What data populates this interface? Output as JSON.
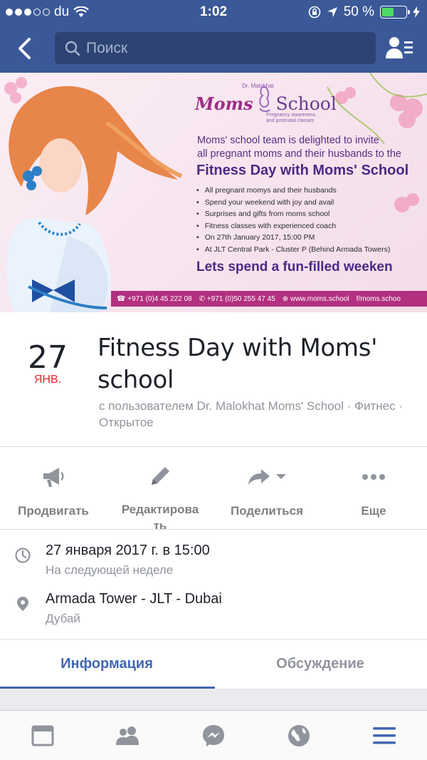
{
  "status_bar": {
    "carrier": "du",
    "time": "1:02",
    "battery_percent": "50 %",
    "battery_level": 0.5
  },
  "nav": {
    "search_placeholder": "Поиск"
  },
  "banner": {
    "logo_prefix": "Dr. Malokhat",
    "logo_moms": "Moms",
    "logo_school": "School",
    "logo_tagline_1": "Pregnancy awareness",
    "logo_tagline_2": "and postnatal classes",
    "intro_line_1": "Moms' school team is delighted to invite",
    "intro_line_2": "all pregnant moms and their husbands to the",
    "headline": "Fitness Day with Moms' School",
    "bullets": [
      "All pregnant momys and their husbands",
      "Spend your weekend with joy and avail",
      "Surprises and gifts from moms school",
      "Fitness classes with experienced coach",
      "On 27th January 2017,  15:00 PM",
      "At JLT Central Park - Cluster P (Behind Armada Towers)"
    ],
    "cta": "Lets spend a fun-filled weeken",
    "contacts": [
      "+971 (0)4 45 222 08",
      "+971 (0)50 255 47 45",
      "www.moms.school",
      "f/moms.schoo"
    ]
  },
  "event": {
    "day": "27",
    "month": "ЯНВ.",
    "title": "Fitness Day with Moms' school",
    "meta": "с пользователем Dr. Malokhat Moms' School · Фитнес · Открытое"
  },
  "actions": [
    {
      "label": "Продвигать",
      "icon": "megaphone-icon"
    },
    {
      "label": "Редактирова ть",
      "icon": "pencil-icon"
    },
    {
      "label": "Поделиться",
      "icon": "share-icon"
    },
    {
      "label": "Еще",
      "icon": "more-icon"
    }
  ],
  "details": {
    "datetime": "27 января 2017 г. в 15:00",
    "datetime_sub": "На следующей неделе",
    "location": "Armada Tower - JLT - Dubai",
    "location_sub": "Дубай"
  },
  "tabs": [
    {
      "label": "Информация",
      "active": true
    },
    {
      "label": "Обсуждение",
      "active": false
    }
  ],
  "tab_bar": [
    "news-feed-icon",
    "friends-icon",
    "messenger-icon",
    "globe-icon",
    "menu-icon"
  ],
  "colors": {
    "brand": "#3b5998",
    "accent": "#4267b2",
    "date_red": "#e0272b",
    "muted": "#90949c"
  }
}
